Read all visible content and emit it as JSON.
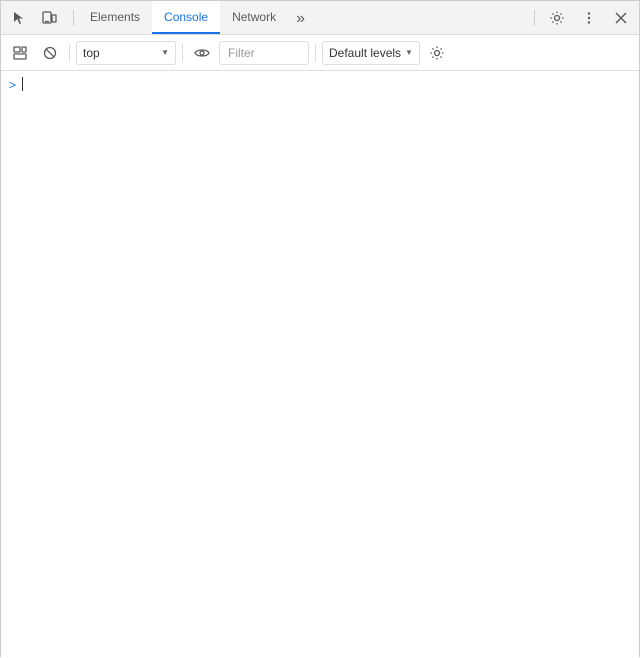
{
  "tabs": {
    "items": [
      {
        "label": "Elements",
        "active": false
      },
      {
        "label": "Console",
        "active": true
      },
      {
        "label": "Network",
        "active": false
      }
    ],
    "more_icon": "»"
  },
  "tab_bar_icons": {
    "inspect_label": "inspect-icon",
    "device_label": "device-icon"
  },
  "toolbar": {
    "context": {
      "value": "top",
      "placeholder": "top"
    },
    "filter": {
      "placeholder": "Filter",
      "value": ""
    },
    "levels": {
      "label": "Default levels"
    }
  },
  "console": {
    "prompt_symbol": ">",
    "cursor_visible": true
  },
  "settings": {
    "gear_icon": "⚙",
    "more_icon": "⋮",
    "close_icon": "✕"
  }
}
